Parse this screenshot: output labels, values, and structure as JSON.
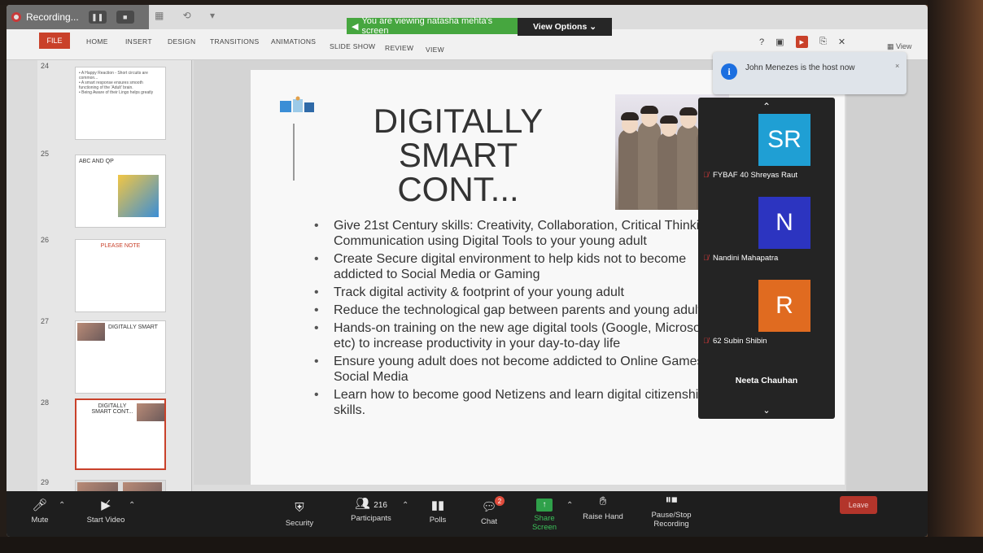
{
  "recording": {
    "label": "Recording...",
    "pause_icon": "pause-icon",
    "stop_icon": "stop-icon"
  },
  "banner": {
    "viewing_text": "You are viewing natasha mehta's screen",
    "view_options": "View Options ⌄"
  },
  "ribbon": {
    "file": "FILE",
    "tabs": [
      "HOME",
      "INSERT",
      "DESIGN",
      "TRANSITIONS",
      "ANIMATIONS",
      "SLIDE SHOW",
      "REVIEW",
      "VIEW"
    ],
    "help": "?",
    "view_label": "View"
  },
  "toast": {
    "message": "John Menezes is the host now",
    "close": "×",
    "info_icon": "i"
  },
  "thumbnails": [
    {
      "num": "24",
      "title": "",
      "lines": [
        "• A Happy Reaction - Short circuits are common...",
        "• A smart response ensures smooth functioning of the 'Adult' brain.",
        "• Being Aware of their Lingo helps greatly"
      ]
    },
    {
      "num": "25",
      "title": "ABC AND QP",
      "lines": []
    },
    {
      "num": "26",
      "title": "PLEASE NOTE",
      "lines": []
    },
    {
      "num": "27",
      "title": "DIGITALLY SMART",
      "lines": []
    },
    {
      "num": "28",
      "title": "DIGITALLY SMART CONT...",
      "lines": []
    },
    {
      "num": "29",
      "title": "",
      "lines": []
    }
  ],
  "slide": {
    "title_lines": [
      "DIGITALLY",
      "SMART",
      "CONT..."
    ],
    "bullets": [
      "Give 21st Century skills: Creativity, Collaboration, Critical Thinking, Communication using Digital Tools to your young adult",
      "Create Secure digital environment to help kids not to become addicted to Social Media or Gaming",
      "Track digital activity & footprint of your young adult",
      "Reduce the technological gap between parents and young adult",
      "Hands-on training on the new age digital tools (Google, Microsoft etc) to increase productivity in your day-to-day life",
      "Ensure young adult does not become addicted to Online Games and Social Media",
      "Learn how to become good Netizens and learn digital citizenship skills."
    ]
  },
  "participants_panel": {
    "up": "⌃",
    "down": "⌄",
    "tiles": [
      {
        "initials": "SR",
        "name": "FYBAF 40 Shreyas Raut",
        "color": "#1f9fd4"
      },
      {
        "initials": "N",
        "name": "Nandini Mahapatra",
        "color": "#2c34c0"
      },
      {
        "initials": "R",
        "name": "62 Subin Shibin",
        "color": "#e06b20"
      }
    ],
    "speaker": "Neeta Chauhan"
  },
  "toolbar": {
    "mute": "Mute",
    "start_video": "Start Video",
    "security": "Security",
    "participants_count": "216",
    "participants": "Participants",
    "polls": "Polls",
    "chat": "Chat",
    "chat_badge": "2",
    "share_screen": "Share Screen",
    "raise_hand": "Raise Hand",
    "pause_stop_recording": "Pause/Stop Recording",
    "leave": "Leave"
  }
}
